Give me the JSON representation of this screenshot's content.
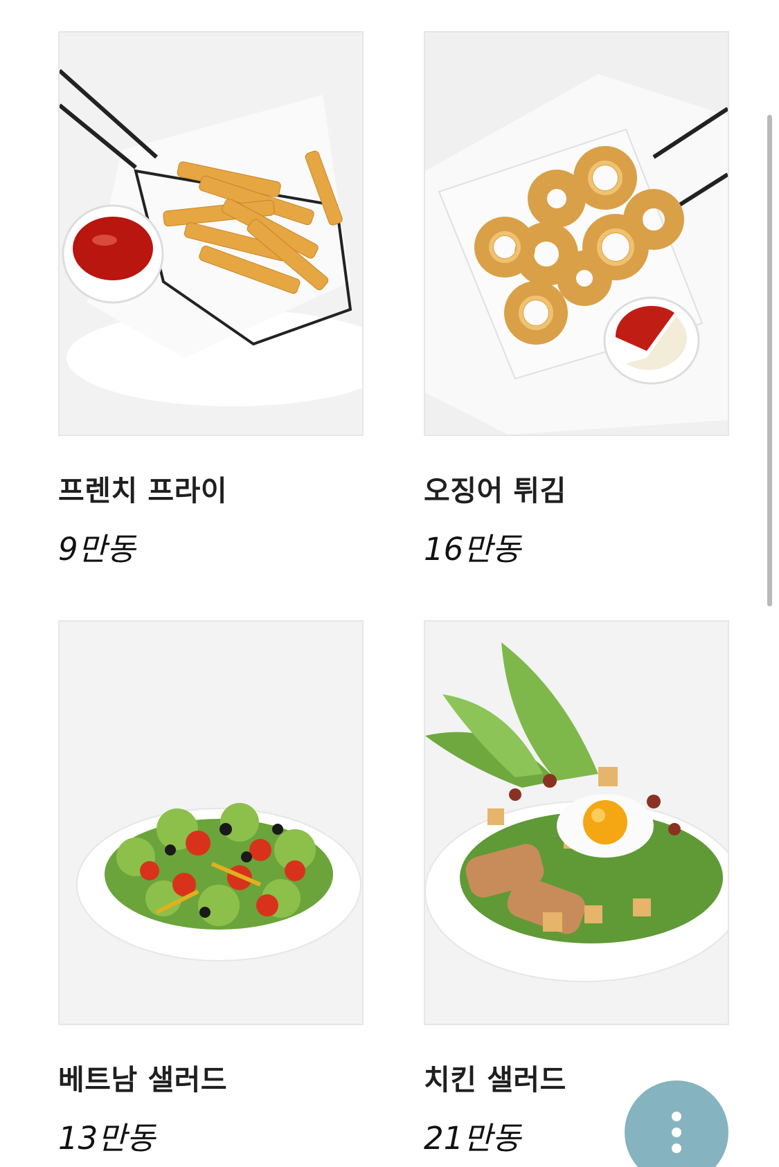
{
  "menu": {
    "items": [
      {
        "name": "프렌치 프라이",
        "price": "9만동",
        "photo": "french-fries"
      },
      {
        "name": "오징어 튀김",
        "price": "16만동",
        "photo": "fried-squid-rings"
      },
      {
        "name": "베트남 샐러드",
        "price": "13만동",
        "photo": "vietnamese-salad"
      },
      {
        "name": "치킨 샐러드",
        "price": "21만동",
        "photo": "chicken-salad"
      }
    ]
  },
  "colors": {
    "fab": "#86b3c0",
    "scrollbar": "#b9b9b9",
    "text": "#1f1f1f"
  },
  "fab": {
    "icon": "more-vertical-icon"
  }
}
